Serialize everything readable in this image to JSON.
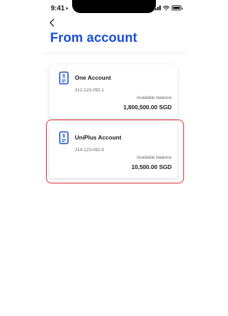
{
  "status_bar": {
    "time": "9:41"
  },
  "header": {
    "title": "From account"
  },
  "accounts": [
    {
      "name": "One Account",
      "number": "312-123-092-1",
      "balance_label": "Available balance",
      "balance": "1,800,500.00 SGD",
      "selected": false
    },
    {
      "name": "UniPlus Account",
      "number": "314-123-092-5",
      "balance_label": "Available balance",
      "balance": "10,500.00 SGD",
      "selected": true
    }
  ],
  "colors": {
    "accent": "#1c4fd6",
    "selection": "#e0262f"
  },
  "icons": {
    "back": "chevron-left-icon",
    "account": "dollar-document-icon",
    "signal": "cellular-signal-icon",
    "wifi": "wifi-icon",
    "battery": "battery-icon"
  }
}
